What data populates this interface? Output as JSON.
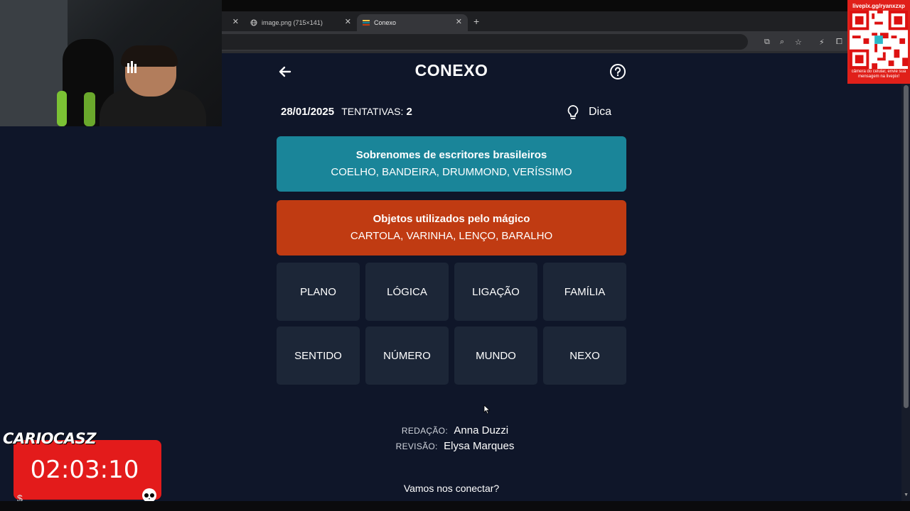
{
  "browser": {
    "tabs": [
      {
        "label": "image.png (715×141)"
      },
      {
        "label": "Conexo"
      }
    ]
  },
  "qr": {
    "header": "livepix.gg/ryanxzxp",
    "footer": "câmera do celular, envie sua mensagem na livepix!"
  },
  "page": {
    "title": "CONEXO",
    "date": "28/01/2025",
    "attempts_label": "TENTATIVAS:",
    "attempts_value": "2",
    "hint_label": "Dica",
    "groups": [
      {
        "title": "Sobrenomes de escritores brasileiros",
        "words": "COELHO, BANDEIRA, DRUMMOND, VERÍSSIMO",
        "color": "#1a8599"
      },
      {
        "title": "Objetos utilizados pelo mágico",
        "words": "CARTOLA, VARINHA, LENÇO, BARALHO",
        "color": "#c03b12"
      }
    ],
    "tiles": [
      "PLANO",
      "LÓGICA",
      "LIGAÇÃO",
      "FAMÍLIA",
      "SENTIDO",
      "NÚMERO",
      "MUNDO",
      "NEXO"
    ],
    "credits": {
      "redacao_label": "REDAÇÃO:",
      "redacao_name": "Anna Duzzi",
      "revisao_label": "REVISÃO:",
      "revisao_name": "Elysa Marques"
    },
    "connect": "Vamos nos conectar?"
  },
  "overlay": {
    "brand": "CARIOCASZ",
    "timer": "02:03:10"
  }
}
